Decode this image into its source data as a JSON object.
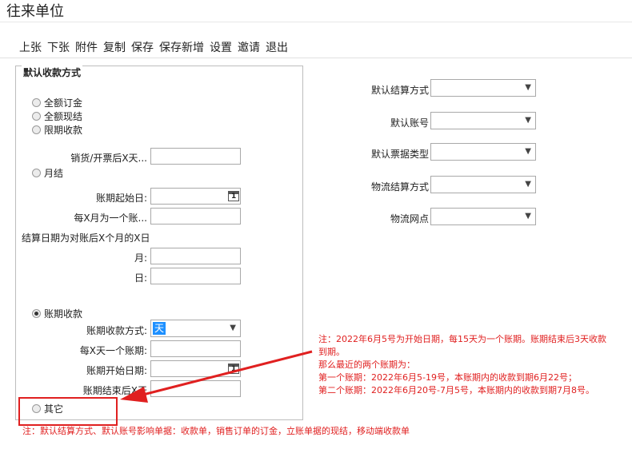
{
  "window": {
    "title": "往来单位"
  },
  "toolbar": [
    "上张",
    "下张",
    "附件",
    "复制",
    "保存",
    "保存新增",
    "设置",
    "邀请",
    "退出"
  ],
  "group": {
    "legend": "默认收款方式",
    "opt_full_order": "全额订金",
    "opt_full_cash": "全额现结",
    "opt_term": "限期收款",
    "lbl_days_after": "销货/开票后X天...",
    "opt_monthly": "月结",
    "lbl_period_start": "账期起始日:",
    "lbl_every_x_month": "每X月为一个账...",
    "lbl_settle_date": "结算日期为对账后X个月的X日",
    "lbl_month": "月:",
    "lbl_day": "日:",
    "opt_period": "账期收款",
    "lbl_period_mode": "账期收款方式:",
    "period_mode_value": "天",
    "lbl_every_x_day": "每X天一个账期:",
    "lbl_period_begin": "账期开始日期:",
    "lbl_period_end": "账期结束后X天",
    "opt_other": "其它"
  },
  "right": {
    "default_settle": "默认结算方式",
    "default_account": "默认账号",
    "default_invoice": "默认票据类型",
    "logistics_settle": "物流结算方式",
    "logistics_point": "物流网点"
  },
  "annotation": {
    "line1": "注：2022年6月5号为开始日期，每15天为一个账期。账期结束后3天收款",
    "line2": "到期。",
    "line3": "那么最近的两个账期为：",
    "line4": "第一个账期：2022年6月5-19号，本账期内的收款到期6月22号；",
    "line5": "第二个账期：2022年6月20号-7月5号，本账期内的收款到期7月8号。"
  },
  "footnote": "注：默认结算方式、默认账号影响单据：收款单，销售订单的订金，立账单据的现结，移动端收款单",
  "colors": {
    "annotation_red": "#e02020",
    "selected_blue": "#1e90ff"
  }
}
